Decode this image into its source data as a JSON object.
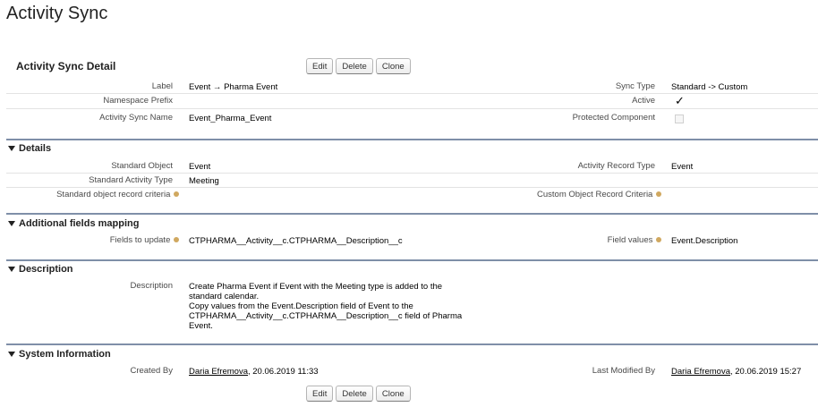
{
  "page": {
    "title": "Activity Sync"
  },
  "detail": {
    "title": "Activity Sync Detail"
  },
  "buttons": {
    "edit": "Edit",
    "delete": "Delete",
    "clone": "Clone"
  },
  "header_fields": {
    "label": {
      "label": "Label",
      "value": "Event → Pharma Event"
    },
    "namespace_prefix": {
      "label": "Namespace Prefix",
      "value": ""
    },
    "activity_sync_name": {
      "label": "Activity Sync Name",
      "value": "Event_Pharma_Event"
    },
    "sync_type": {
      "label": "Sync Type",
      "value": "Standard -> Custom"
    },
    "active": {
      "label": "Active",
      "checked": true,
      "mark": "✓"
    },
    "protected_component": {
      "label": "Protected Component",
      "checked": false
    }
  },
  "sections": {
    "details": {
      "title": "Details",
      "standard_object": {
        "label": "Standard Object",
        "value": "Event"
      },
      "standard_activity_type": {
        "label": "Standard Activity Type",
        "value": "Meeting"
      },
      "standard_object_record_criteria": {
        "label": "Standard object record criteria",
        "value": ""
      },
      "activity_record_type": {
        "label": "Activity Record Type",
        "value": "Event"
      },
      "custom_object_record_criteria": {
        "label": "Custom Object Record Criteria",
        "value": ""
      }
    },
    "additional_fields_mapping": {
      "title": "Additional fields mapping",
      "fields_to_update": {
        "label": "Fields to update",
        "value": "CTPHARMA__Activity__c.CTPHARMA__Description__c"
      },
      "field_values": {
        "label": "Field values",
        "value": "Event.Description"
      }
    },
    "description": {
      "title": "Description",
      "label": "Description",
      "value": "Create Pharma Event if Event with the Meeting type is added to the\nstandard calendar.\nCopy values from the Event.Description field of Event to the\nCTPHARMA__Activity__c.CTPHARMA__Description__c field of Pharma\nEvent."
    },
    "system_information": {
      "title": "System Information",
      "created_by": {
        "label": "Created By",
        "user": "Daria Efremova",
        "date": ", 20.06.2019 11:33"
      },
      "last_modified_by": {
        "label": "Last Modified By",
        "user": "Daria Efremova",
        "date": ", 20.06.2019 15:27"
      }
    }
  },
  "colors": {
    "section_rule": "#7f8fa8",
    "help_icon": "#d0a860"
  },
  "icons": {
    "section_toggle": "triangle-down-icon",
    "help": "help-icon",
    "checkmark": "checkmark-icon"
  }
}
